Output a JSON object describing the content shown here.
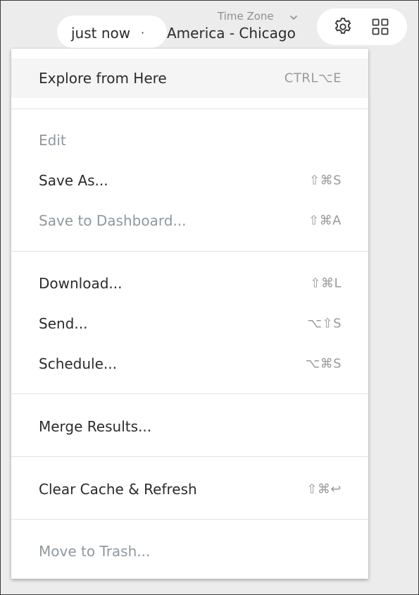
{
  "header": {
    "time_text": "just now",
    "time_separator": "·",
    "timezone_label": "Time Zone",
    "timezone_value": "America - Chicago"
  },
  "icons": {
    "settings": "gear-icon",
    "dashboard": "grid-icon",
    "timezone_toggle": "chevron-down-icon"
  },
  "menu": {
    "explore": {
      "label": "Explore from Here",
      "shortcut": "CTRL⌥E"
    },
    "edit": {
      "label": "Edit"
    },
    "save_as": {
      "label": "Save As...",
      "shortcut": "⇧⌘S"
    },
    "save_dashboard": {
      "label": "Save to Dashboard...",
      "shortcut": "⇧⌘A"
    },
    "download": {
      "label": "Download...",
      "shortcut": "⇧⌘L"
    },
    "send": {
      "label": "Send...",
      "shortcut": "⌥⇧S"
    },
    "schedule": {
      "label": "Schedule...",
      "shortcut": "⌥⌘S"
    },
    "merge": {
      "label": "Merge Results..."
    },
    "clear_cache": {
      "label": "Clear Cache & Refresh",
      "shortcut": "⇧⌘↩"
    },
    "trash": {
      "label": "Move to Trash..."
    }
  },
  "colors": {
    "text": "#2b2b2b",
    "disabled_text": "#8f989f",
    "shortcut_text": "#9a9a9a",
    "highlight": "#f5f5f5",
    "background": "#ececec"
  }
}
